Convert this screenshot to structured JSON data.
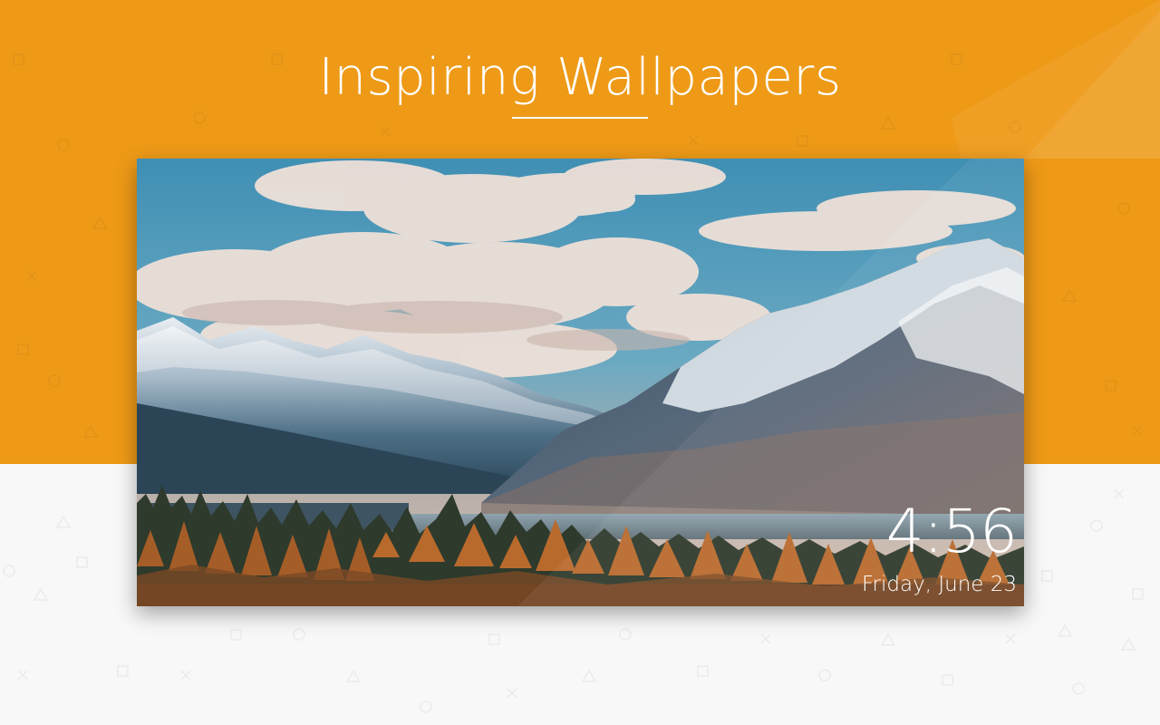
{
  "header": {
    "title": "Inspiring Wallpapers"
  },
  "lock_screen_preview": {
    "time": "4:56",
    "date": "Friday, June 23",
    "wallpaper": "mountain-lake-landscape"
  },
  "colors": {
    "banner": "#ee9a17",
    "background": "#f8f8f8",
    "text": "#ffffff"
  }
}
